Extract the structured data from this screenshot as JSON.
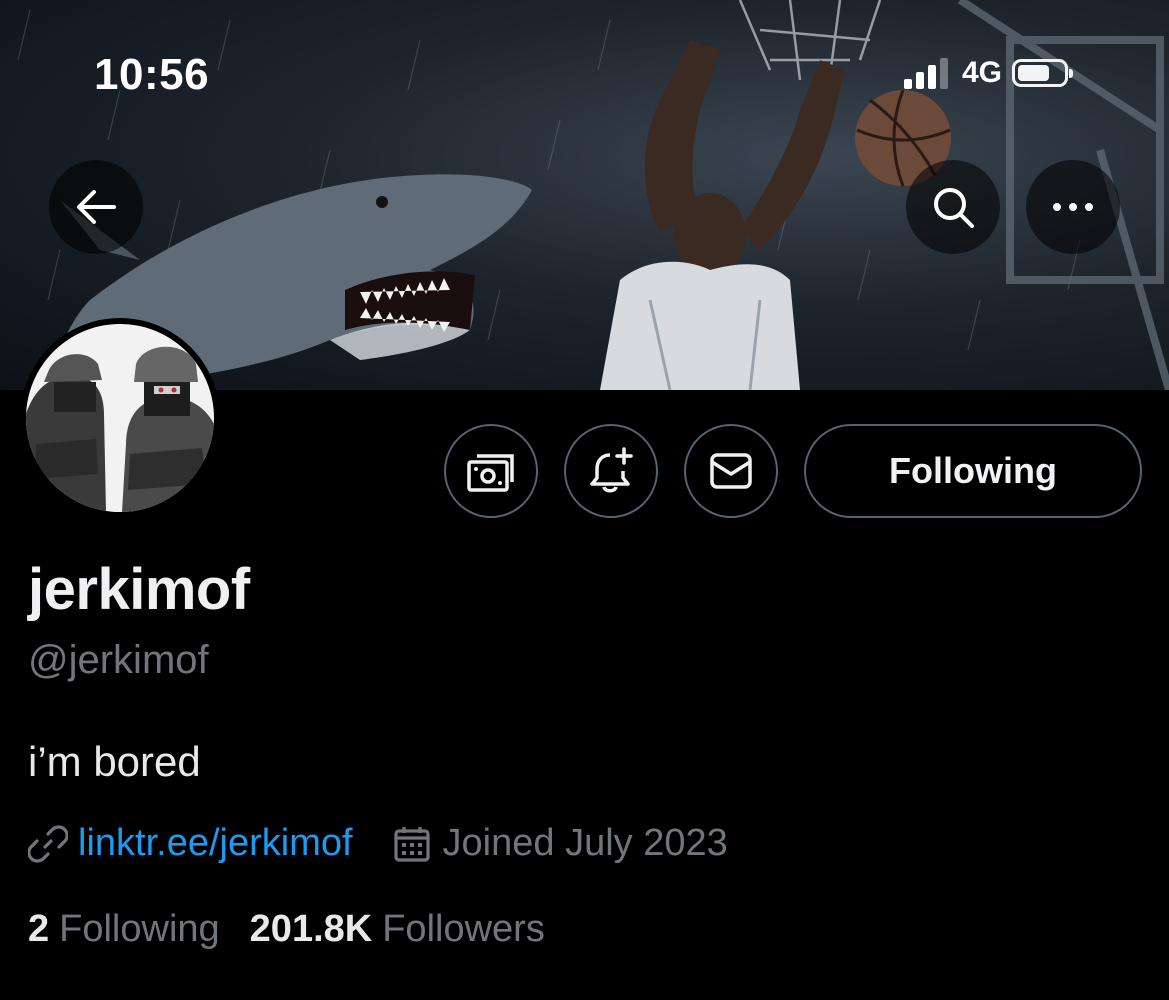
{
  "status_bar": {
    "time": "10:56",
    "network": "4G",
    "signal_bars": 3,
    "battery_level": 0.7
  },
  "header": {
    "back_icon": "arrow-left-icon",
    "search_icon": "search-icon",
    "more_icon": "more-horizontal-icon"
  },
  "actions": {
    "tip_icon": "money-icon",
    "notify_icon": "bell-plus-icon",
    "message_icon": "envelope-icon",
    "following_label": "Following"
  },
  "profile": {
    "display_name": "jerkimof",
    "handle": "@jerkimof",
    "bio": "i’m bored",
    "link": "linktr.ee/jerkimof",
    "joined": "Joined July 2023",
    "following_count": "2",
    "following_label": "Following",
    "followers_count": "201.8K",
    "followers_label": "Followers"
  },
  "colors": {
    "background": "#000000",
    "accent_link": "#1d9bf0",
    "secondary_text": "#71767b",
    "border": "#536471"
  }
}
